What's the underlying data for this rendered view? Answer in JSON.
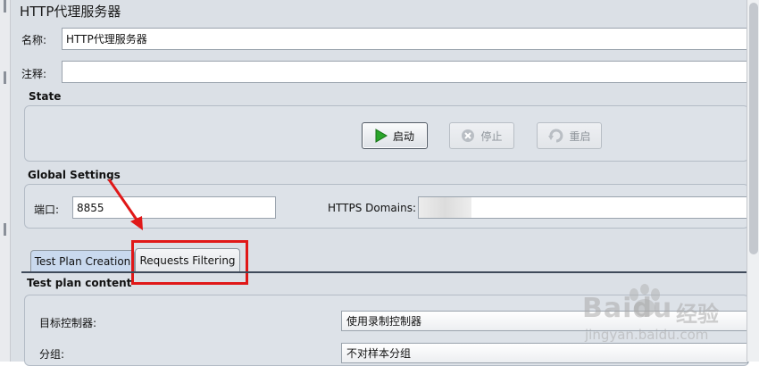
{
  "window_title": "HTTP代理服务器",
  "name_field": {
    "label": "名称:",
    "value": "HTTP代理服务器"
  },
  "comment_field": {
    "label": "注释:",
    "value": ""
  },
  "state": {
    "title": "State",
    "buttons": {
      "start": "启动",
      "stop": "停止",
      "restart": "重启"
    }
  },
  "global_settings": {
    "title": "Global Settings",
    "port_label": "端口:",
    "port_value": "8855",
    "https_domains_label": "HTTPS Domains:",
    "https_domains_value": ""
  },
  "tabs": [
    {
      "label": "Test Plan Creation",
      "active": true
    },
    {
      "label": "Requests Filtering",
      "active": false
    }
  ],
  "test_plan_content": {
    "title": "Test plan content",
    "target_controller_label": "目标控制器:",
    "target_controller_value": "使用录制控制器",
    "grouping_label": "分组:",
    "grouping_value": "不对样本分组"
  },
  "watermark": {
    "brand": "Baidu",
    "brand_cn": "经验",
    "url": "jingyan.baidu.com"
  },
  "colors": {
    "annotation_red": "#e01818",
    "active_tab": "#c9d9ee",
    "panel_bg": "#dbe0e6"
  }
}
